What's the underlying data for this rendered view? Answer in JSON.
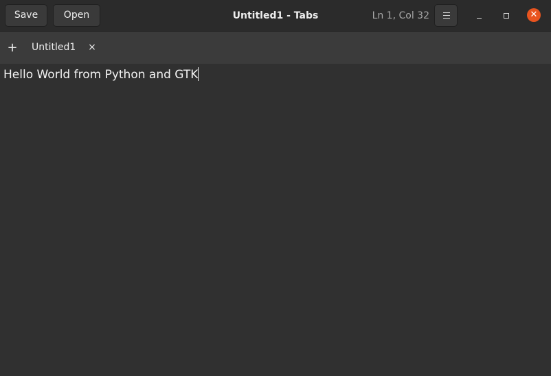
{
  "window": {
    "title": "Untitled1 - Tabs"
  },
  "headerbar": {
    "save_label": "Save",
    "open_label": "Open",
    "cursor_position": "Ln 1, Col 32",
    "menu_icon": "hamburger-menu-icon",
    "minimize_icon": "minimize-icon",
    "maximize_icon": "maximize-icon",
    "close_icon": "close-icon",
    "close_glyph": "✕",
    "close_color": "#e9541f"
  },
  "tabs": {
    "new_tab_glyph": "+",
    "items": [
      {
        "label": "Untitled1",
        "close_glyph": "×"
      }
    ]
  },
  "editor": {
    "content": "Hello World from Python and GTK"
  }
}
